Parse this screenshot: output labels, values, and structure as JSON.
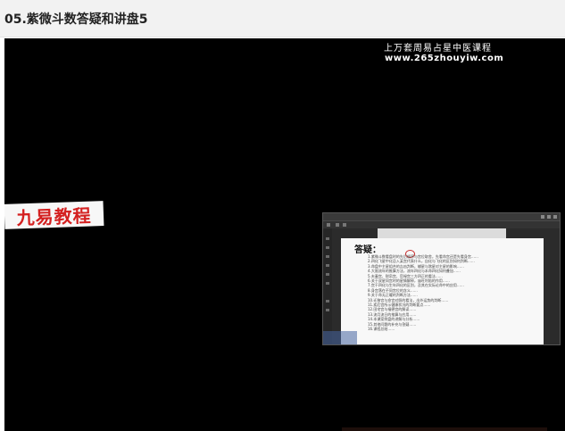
{
  "page": {
    "title": "05.紫微斗数答疑和讲盘5"
  },
  "video": {
    "watermark": {
      "line1": "上万套周易占星中医课程",
      "line2": "www.265zhouyiw.com"
    },
    "logo": {
      "text": "九易教程"
    },
    "document_viewer": {
      "heading": "答疑：",
      "lines": [
        "1.紫微斗数看盘时的先后顺序与宫位取舍，先看命宫还是先看身宫……",
        "2.四化飞星中化忌入某宫代表什么，自化与飞化的区别如何判断……",
        "3.命盘中主星组合的吉凶判断，辅星与煞星对主星的影响……",
        "4.大限流年的推算方法，流年四化与本命四化如何叠加……",
        "5.夫妻宫、财帛宫、官禄宫三方四正的看法……",
        "6.关于双星同宫时的星情解释，庙旺利陷的作用……",
        "7.宫干四化与生年四化的区别，及其在实际论命中的应用……",
        "8.身宫落在不同宫位的含义……",
        "9.关于命无正曜的判断方法……",
        "10.迁移宫与命宫对照的看法，出外运势的判断……",
        "11.疾厄宫所示健康状况的判断要点……",
        "12.田宅宫与福德宫的解读……",
        "13.流月流日的推算与应用……",
        "14.本课案例盘的讲解与分析……",
        "15.其他问题的补充与答疑……",
        "16.课程总结……"
      ]
    }
  },
  "colors": {
    "header_background": "#f2f2f2",
    "video_background": "#000000",
    "logo_text": "#d42020",
    "circle_mark": "#c83030"
  }
}
